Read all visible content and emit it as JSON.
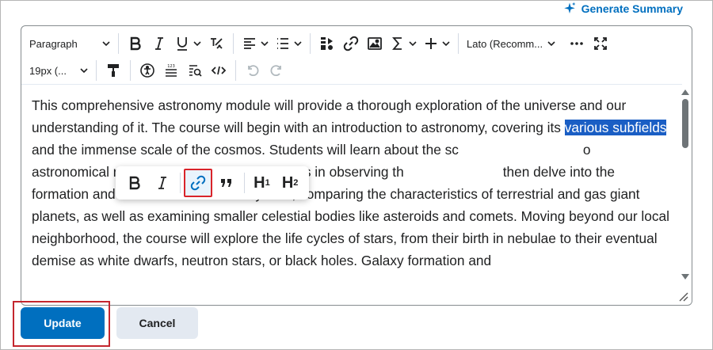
{
  "header": {
    "generate_summary_label": "Generate Summary",
    "accent": "#006fbf"
  },
  "toolbar": {
    "paragraph_label": "Paragraph",
    "font_label": "Lato (Recomm...",
    "size_label": "19px (...",
    "icons": [
      "bold-icon",
      "italic-icon",
      "underline-icon",
      "strikethrough-icon",
      "align-icon",
      "list-icon",
      "insert-stuff-icon",
      "link-icon",
      "image-icon",
      "equation-icon",
      "insert-icon",
      "font-icon",
      "more-icon",
      "fullscreen-icon",
      "format-painter-icon",
      "accessibility-icon",
      "word-count-icon",
      "find-replace-icon",
      "source-code-icon",
      "undo-icon",
      "redo-icon"
    ]
  },
  "content": {
    "before_selection": "This comprehensive astronomy module will provide a thorough exploration of the universe and our understanding of it. The course will begin with an introduction to astronomy, covering its ",
    "selection": "various subfields",
    "after_selection_line3": " and the immense scale of the cosmos. Students will learn",
    "line4_start": "about the sc",
    "line4_end": "o astronomical research and gain practical skills in",
    "line5_start": "observing th",
    "line5_end": "then delve into the formation and structure of our",
    "rest": "solar system, comparing the characteristics of terrestrial and gas giant planets, as well as examining smaller celestial bodies like asteroids and comets. Moving beyond our local neighborhood, the course will explore the life cycles of stars, from their birth in nebulae to their eventual demise as white dwarfs, neutron stars, or black holes. Galaxy formation and"
  },
  "popup": {
    "h1_label": "H",
    "h1_sub": "1",
    "h2_label": "H",
    "h2_sub": "2"
  },
  "actions": {
    "update_label": "Update",
    "cancel_label": "Cancel"
  }
}
